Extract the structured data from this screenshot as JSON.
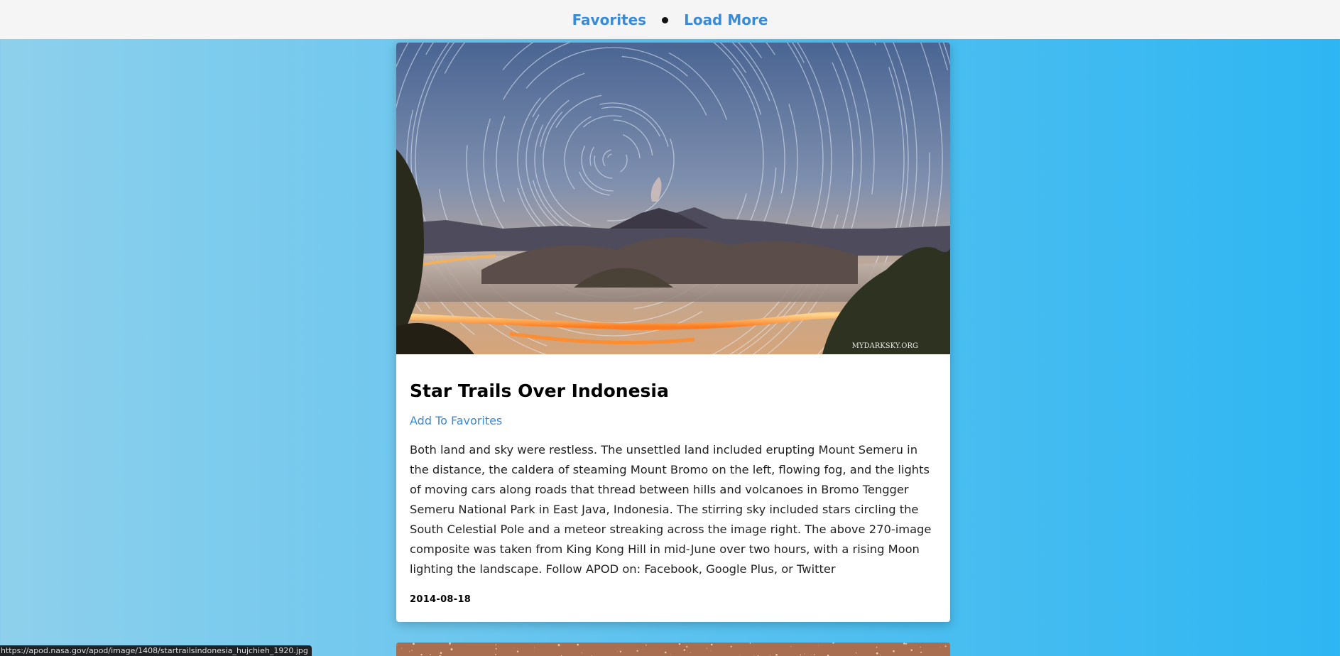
{
  "nav": {
    "favorites_label": "Favorites",
    "load_more_label": "Load More"
  },
  "colors": {
    "link": "#3a8ad6",
    "topbar_bg": "#f5f5f5",
    "gradient_left": "#8ed0ec",
    "gradient_right": "#2eb6f2"
  },
  "post": {
    "title": "Star Trails Over Indonesia",
    "add_favorite_label": "Add To Favorites",
    "image_credit": "MYDARKSKY.ORG",
    "explanation": "Both land and sky were restless. The unsettled land included erupting Mount Semeru in the distance, the caldera of steaming Mount Bromo on the left, flowing fog, and the lights of moving cars along roads that thread between hills and volcanoes in Bromo Tengger Semeru National Park in East Java, Indonesia. The stirring sky included stars circling the South Celestial Pole and a meteor streaking across the image right. The above 270-image composite was taken from King Kong Hill in mid-June over two hours, with a rising Moon lighting the landscape. Follow APOD on: Facebook, Google Plus, or Twitter",
    "date": "2014-08-18"
  },
  "status_bar": {
    "url": "https://apod.nasa.gov/apod/image/1408/startrailsindonesia_hujchieh_1920.jpg"
  }
}
